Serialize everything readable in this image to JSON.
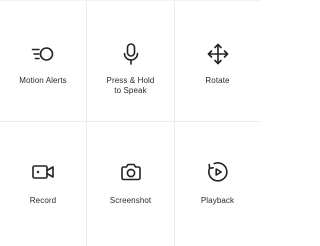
{
  "controls": [
    {
      "label": "Motion Alerts",
      "icon": "motion-alerts-icon"
    },
    {
      "label": "Press & Hold\nto Speak",
      "icon": "microphone-icon"
    },
    {
      "label": "Rotate",
      "icon": "move-arrows-icon"
    },
    {
      "label": "Record",
      "icon": "video-camera-icon"
    },
    {
      "label": "Screenshot",
      "icon": "camera-icon"
    },
    {
      "label": "Playback",
      "icon": "playback-icon"
    }
  ],
  "colors": {
    "icon_stroke": "#222222",
    "divider": "#ececec",
    "background": "#ffffff"
  }
}
